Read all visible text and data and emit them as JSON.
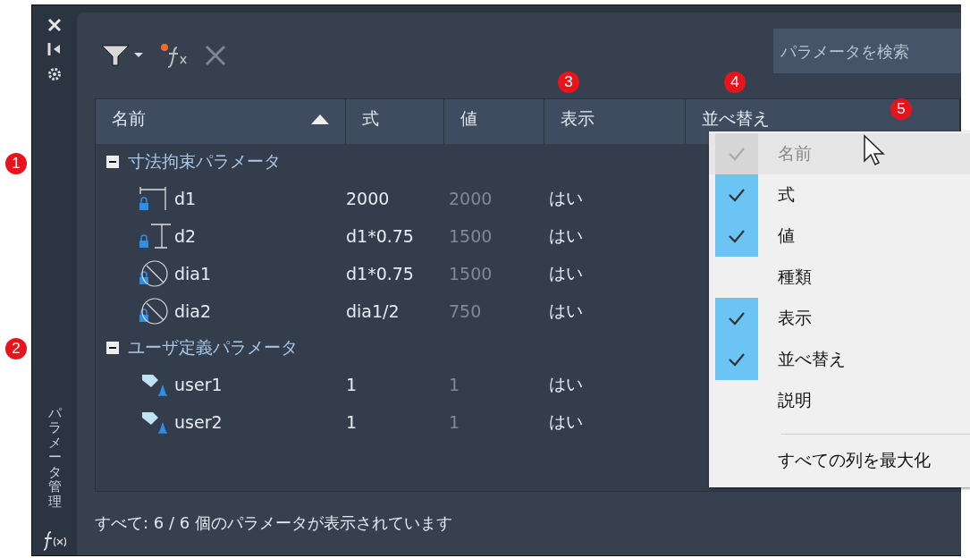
{
  "sidebar": {
    "title": "パラメータ管理"
  },
  "search": {
    "placeholder": "パラメータを検索"
  },
  "table": {
    "columns": [
      {
        "label": "名前",
        "sorted": true
      },
      {
        "label": "式",
        "sorted": false
      },
      {
        "label": "値",
        "sorted": false
      },
      {
        "label": "表示",
        "sorted": false
      },
      {
        "label": "並べ替え",
        "sorted": false
      }
    ],
    "groups": [
      {
        "label": "寸法拘束パラメータ",
        "expanded": true,
        "rows": [
          {
            "kind": "horizontal",
            "name": "d1",
            "expression": "2000",
            "value": "2000",
            "show": "はい"
          },
          {
            "kind": "vertical",
            "name": "d2",
            "expression": "d1*0.75",
            "value": "1500",
            "show": "はい"
          },
          {
            "kind": "diameter",
            "name": "dia1",
            "expression": "d1*0.75",
            "value": "1500",
            "show": "はい"
          },
          {
            "kind": "diameter",
            "name": "dia2",
            "expression": "dia1/2",
            "value": "750",
            "show": "はい"
          }
        ]
      },
      {
        "label": "ユーザ定義パラメータ",
        "expanded": true,
        "rows": [
          {
            "kind": "user",
            "name": "user1",
            "expression": "1",
            "value": "1",
            "show": "はい"
          },
          {
            "kind": "user",
            "name": "user2",
            "expression": "1",
            "value": "1",
            "show": "はい"
          }
        ]
      }
    ]
  },
  "context_menu": {
    "items": [
      {
        "label": "名前",
        "checked": true,
        "disabled": true
      },
      {
        "label": "式",
        "checked": true,
        "disabled": false
      },
      {
        "label": "値",
        "checked": true,
        "disabled": false
      },
      {
        "label": "種類",
        "checked": false,
        "disabled": false
      },
      {
        "label": "表示",
        "checked": true,
        "disabled": false
      },
      {
        "label": "並べ替え",
        "checked": true,
        "disabled": false
      },
      {
        "label": "説明",
        "checked": false,
        "disabled": false
      }
    ],
    "footer": "すべての列を最大化"
  },
  "status_bar": "すべて: 6 / 6 個のパラメータが表示されています",
  "callouts": [
    "1",
    "2",
    "3",
    "4",
    "5"
  ]
}
